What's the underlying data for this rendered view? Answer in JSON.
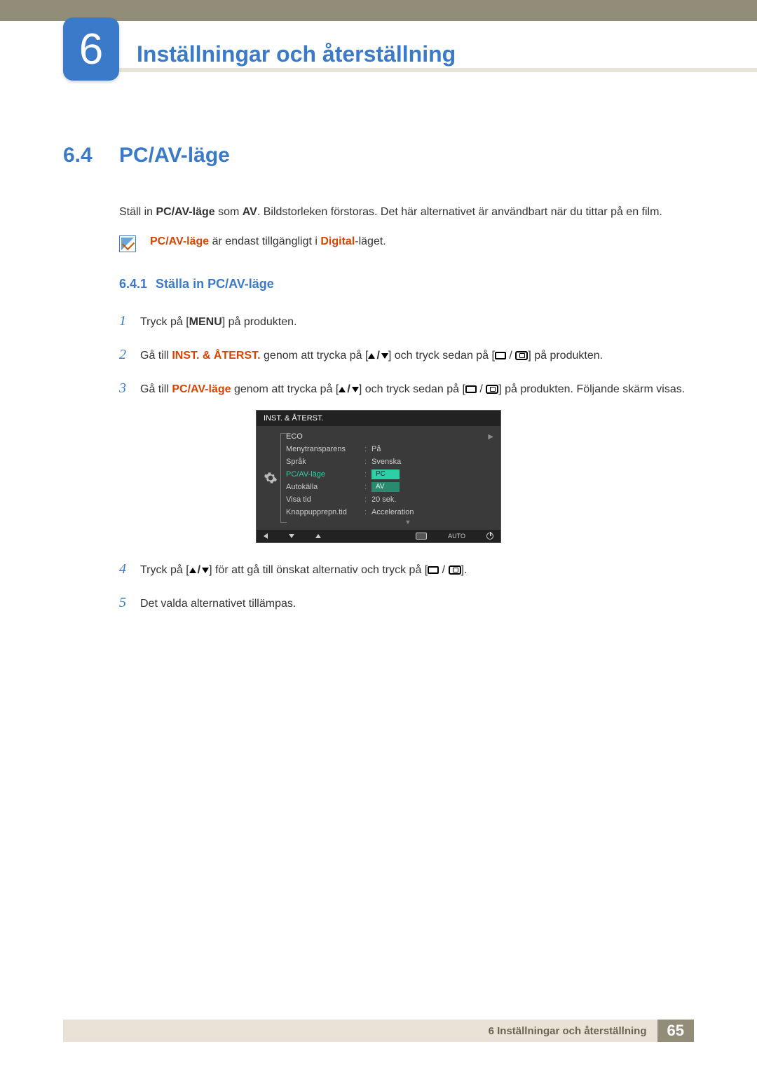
{
  "chapter": {
    "number": "6",
    "title": "Inställningar och återställning"
  },
  "section": {
    "number": "6.4",
    "title": "PC/AV-läge"
  },
  "intro": {
    "pre": "Ställ in ",
    "term1": "PC/AV-läge",
    "mid1": " som ",
    "term2": "AV",
    "post": ". Bildstorleken förstoras. Det här alternativet är användbart när du tittar på en film."
  },
  "note": {
    "term": "PC/AV-läge",
    "mid": " är endast tillgängligt i ",
    "digital": "Digital",
    "post": "-läget."
  },
  "subsection": {
    "number": "6.4.1",
    "title": "Ställa in PC/AV-läge"
  },
  "steps": {
    "s1": {
      "pre": "Tryck på [",
      "menu": "MENU",
      "post": "] på produkten."
    },
    "s2": {
      "pre": "Gå till ",
      "term": "INST. & ÅTERST.",
      "mid": " genom att trycka på [",
      "mid2": "] och tryck sedan på [",
      "post": "] på produkten."
    },
    "s3": {
      "pre": "Gå till ",
      "term": "PC/AV-läge",
      "mid": " genom att trycka på [",
      "mid2": "] och tryck sedan på [",
      "post": "] på produkten. Följande skärm visas."
    },
    "s4": {
      "pre": "Tryck på [",
      "mid": "] för att gå till önskat alternativ och tryck på [",
      "post": "]."
    },
    "s5": "Det valda alternativet tillämpas."
  },
  "osd": {
    "title": "INST. & ÅTERST.",
    "rows": [
      {
        "label": "ECO",
        "value": "",
        "caret": "▶"
      },
      {
        "label": "Menytransparens",
        "value": "På"
      },
      {
        "label": "Språk",
        "value": "Svenska"
      },
      {
        "label": "PC/AV-läge",
        "value": "",
        "active": true
      },
      {
        "label": "Autokälla",
        "value": ""
      },
      {
        "label": "Visa tid",
        "value": "20 sek."
      },
      {
        "label": "Knappupprepn.tid",
        "value": "Acceleration"
      }
    ],
    "options": [
      "PC",
      "AV"
    ],
    "footer_auto": "AUTO"
  },
  "footer": {
    "text": "6 Inställningar och återställning",
    "page": "65"
  }
}
